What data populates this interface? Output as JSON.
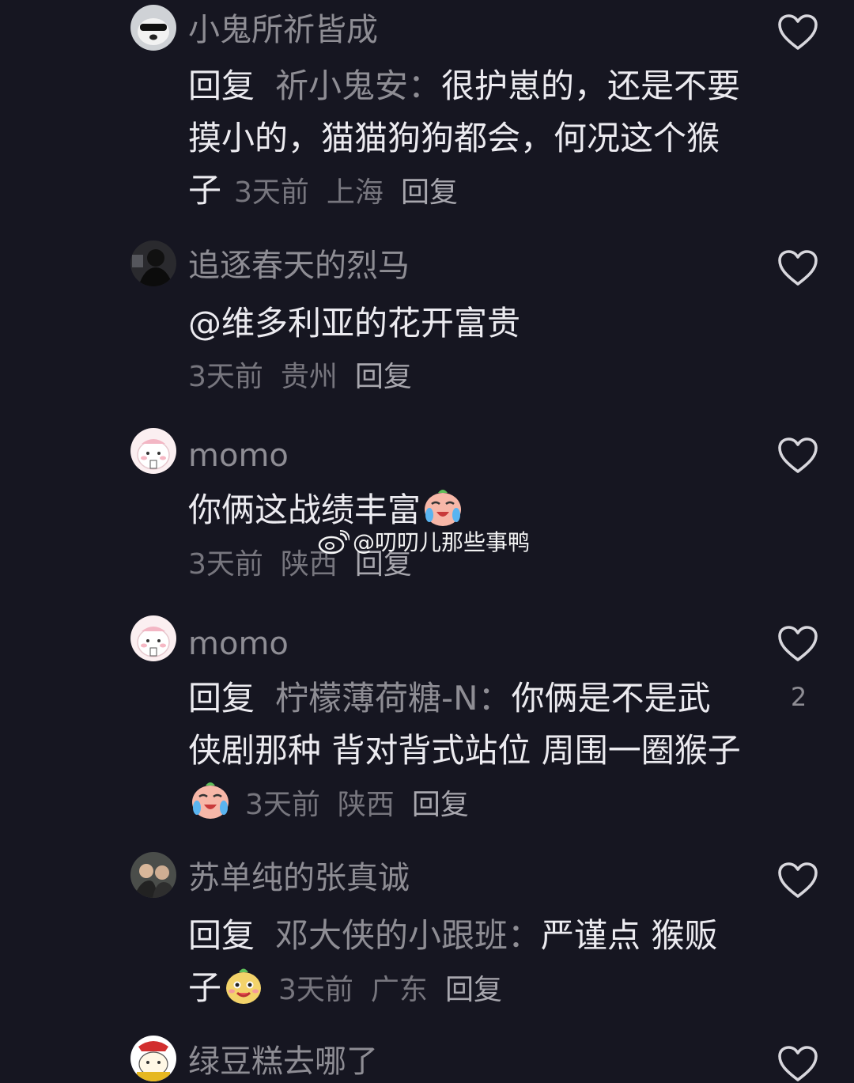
{
  "comments": [
    {
      "username": "小鬼所祈皆成",
      "reply_label": "回复",
      "reply_target": "祈小鬼安：",
      "text": "很护崽的，还是不要摸小的，猫猫狗狗都会，何况这个猴子",
      "time": "3天前",
      "location": "上海",
      "reply": "回复"
    },
    {
      "username": "追逐春天的烈马",
      "text": "@维多利亚的花开富贵",
      "time": "3天前",
      "location": "贵州",
      "reply": "回复"
    },
    {
      "username": "momo",
      "text": "你俩这战绩丰富",
      "emoji": "crying-laughing-emoji",
      "time": "3天前",
      "location": "陕西",
      "reply": "回复"
    },
    {
      "username": "momo",
      "reply_label": "回复",
      "reply_target": "柠檬薄荷糖-N：",
      "text": "你俩是不是武侠剧那种 背对背式站位 周围一圈猴子",
      "emoji": "crying-laughing-emoji",
      "time": "3天前",
      "location": "陕西",
      "reply": "回复",
      "likes": "2"
    },
    {
      "username": "苏单纯的张真诚",
      "reply_label": "回复",
      "reply_target": "邓大侠的小跟班：",
      "text": "严谨点 猴贩子",
      "emoji": "grinning-emoji",
      "time": "3天前",
      "location": "广东",
      "reply": "回复"
    },
    {
      "username": "绿豆糕去哪了"
    }
  ],
  "watermark": "@叨叨儿那些事鸭",
  "icons": {
    "like": "heart-outline-icon",
    "watermark": "weibo-logo-icon"
  },
  "colors": {
    "background": "#161621",
    "username": "#8e8d94",
    "text": "#ecebf0",
    "meta": "#77767e"
  }
}
